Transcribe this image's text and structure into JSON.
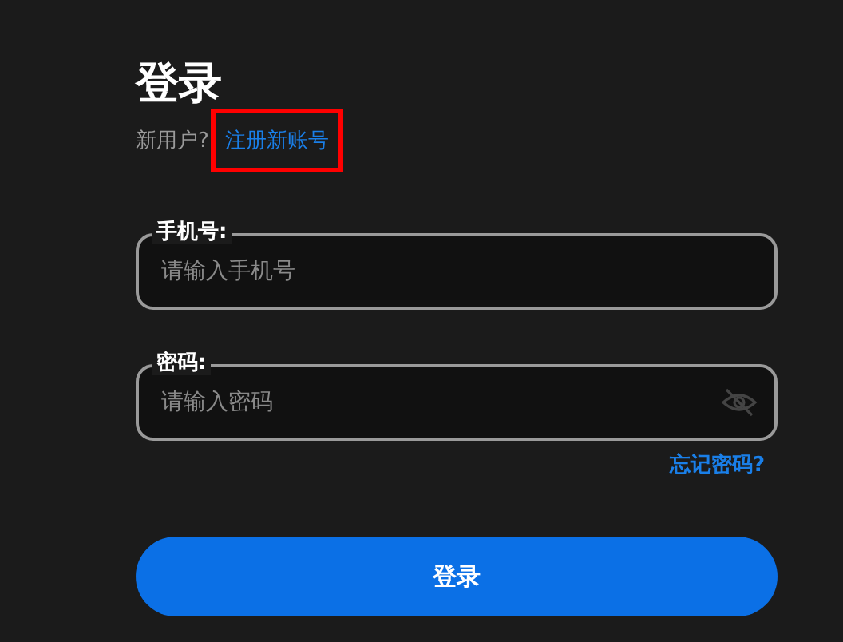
{
  "title": "登录",
  "signup": {
    "prompt": "新用户?",
    "link": "注册新账号",
    "highlighted": true
  },
  "fields": [
    {
      "kind": "text",
      "label": "手机号:",
      "placeholder": "请输入手机号"
    },
    {
      "kind": "password",
      "label": "密码:",
      "placeholder": "请输入密码"
    }
  ],
  "forgot_link": "忘记密码?",
  "submit_button": "登录"
}
